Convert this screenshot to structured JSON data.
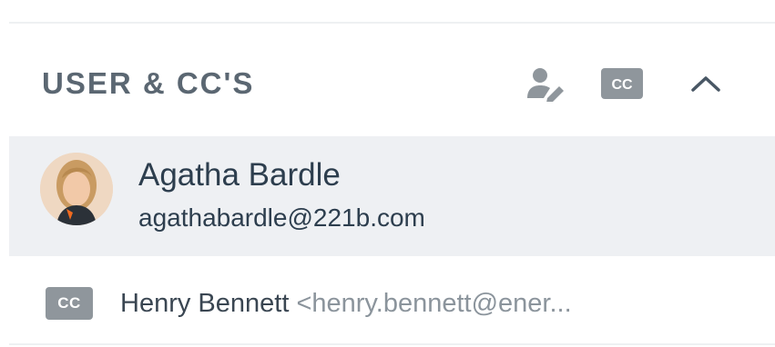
{
  "section": {
    "title": "USER & CC'S",
    "actions": {
      "edit_user_icon": "user-edit-icon",
      "cc_toggle_label": "CC",
      "collapse_icon": "chevron-up-icon"
    }
  },
  "user": {
    "name": "Agatha Bardle",
    "email": "agathabardle@221b.com"
  },
  "cc_list": [
    {
      "badge": "CC",
      "name": "Henry Bennett",
      "email": "<henry.bennett@ener..."
    }
  ],
  "colors": {
    "title": "#5b6772",
    "selected_row_bg": "#eef0f3",
    "primary_text": "#2d3e4e",
    "muted_text": "#8b949c",
    "badge_bg": "#8f969c"
  }
}
